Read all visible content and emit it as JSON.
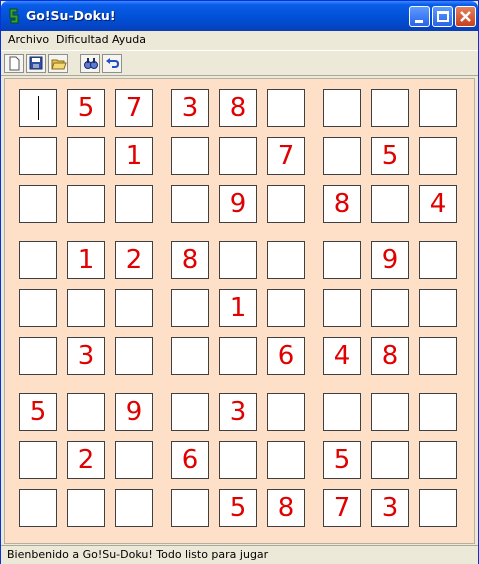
{
  "window": {
    "title": "Go!Su-Doku!"
  },
  "menu": {
    "items": [
      "Archivo",
      "Dificultad",
      "Ayuda"
    ]
  },
  "toolbar": {
    "buttons": [
      "new-icon",
      "save-icon",
      "open-icon",
      "find-icon",
      "undo-icon"
    ]
  },
  "board": {
    "rows": [
      [
        "",
        "5",
        "7",
        "3",
        "8",
        "",
        "",
        "",
        ""
      ],
      [
        "",
        "",
        "1",
        "",
        "",
        "7",
        "",
        "5",
        ""
      ],
      [
        "",
        "",
        "",
        "",
        "9",
        "",
        "8",
        "",
        "4"
      ],
      [
        "",
        "1",
        "2",
        "8",
        "",
        "",
        "",
        "9",
        ""
      ],
      [
        "",
        "",
        "",
        "",
        "1",
        "",
        "",
        "",
        ""
      ],
      [
        "",
        "3",
        "",
        "",
        "",
        "6",
        "4",
        "8",
        ""
      ],
      [
        "5",
        "",
        "9",
        "",
        "3",
        "",
        "",
        "",
        ""
      ],
      [
        "",
        "2",
        "",
        "6",
        "",
        "",
        "5",
        "",
        ""
      ],
      [
        "",
        "",
        "",
        "",
        "5",
        "8",
        "7",
        "3",
        ""
      ]
    ],
    "digit_color": "#E00000",
    "background_color": "#FEE0C9"
  },
  "status": {
    "text": "Bienbenido a Go!Su-Doku! Todo listo para jugar"
  }
}
